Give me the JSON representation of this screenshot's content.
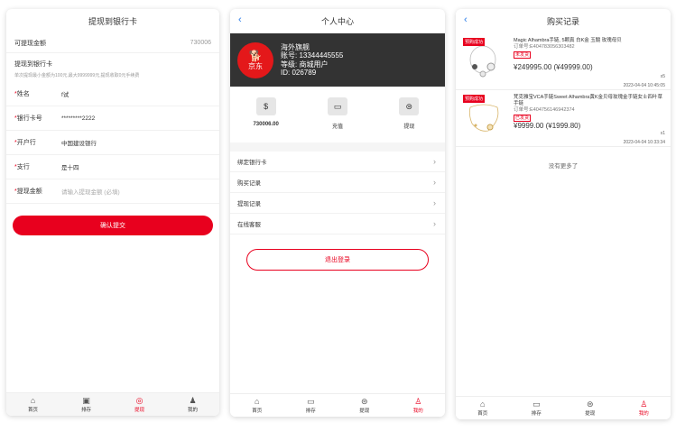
{
  "withdraw": {
    "title": "提现到银行卡",
    "balance_label": "可提现金额",
    "balance_value": "730006",
    "notice_title": "提现到银行卡",
    "notice_text": "单次提现最小金额为100元,最大9999999元,提现收取0元手续费",
    "fields": [
      {
        "label": "姓名",
        "value": "f试"
      },
      {
        "label": "银行卡号",
        "value": "*********2222"
      },
      {
        "label": "开户行",
        "value": "中国建设银行"
      },
      {
        "label": "支行",
        "value": "是十四"
      },
      {
        "label": "提现金额",
        "value": "",
        "placeholder": "请输入提现金额 (必填)"
      }
    ],
    "submit_label": "确认提交"
  },
  "profile": {
    "title": "个人中心",
    "logo_text": "京东",
    "nickname": "海外旗舰",
    "account": "账号: 13344445555",
    "level": "等级: 商城用户",
    "user_id": "ID: 026789",
    "stats": [
      {
        "icon": "money-bag-icon",
        "value": "730006.00"
      },
      {
        "icon": "wallet-icon",
        "value": "充值"
      },
      {
        "icon": "withdraw-icon",
        "value": "提现"
      }
    ],
    "menu": [
      "绑定银行卡",
      "购买记录",
      "提现记录",
      "在线客服"
    ],
    "logout_label": "退出登录"
  },
  "orders": {
    "title": "购买记录",
    "items": [
      {
        "ribbon": "预购成功",
        "name": "Magic Alhambra手链, 5颗真 白K金 玉髓 玫瑰母贝",
        "order_no": "订单号:E404783056303482",
        "status": "未发货",
        "price": "¥249995.00 (¥49999.00)",
        "qty": "x5",
        "date": "2023-04-04 10:45:05"
      },
      {
        "ribbon": "预购成功",
        "name": "梵克雅宝VCA手链Sweet Alhambra黄K金贝母玫瑰金手链女士四叶草手链",
        "order_no": "订单号:E404756146942374",
        "status": "已发货",
        "price": "¥9999.00 (¥1999.80)",
        "qty": "x1",
        "date": "2023-04-04 10:33:34"
      }
    ],
    "no_more": "没有更多了"
  },
  "tabbar": [
    "首页",
    "排存",
    "提现",
    "我的"
  ],
  "colors": {
    "accent": "#e8001e",
    "dark_header": "#333333",
    "link": "#2b7de9"
  }
}
